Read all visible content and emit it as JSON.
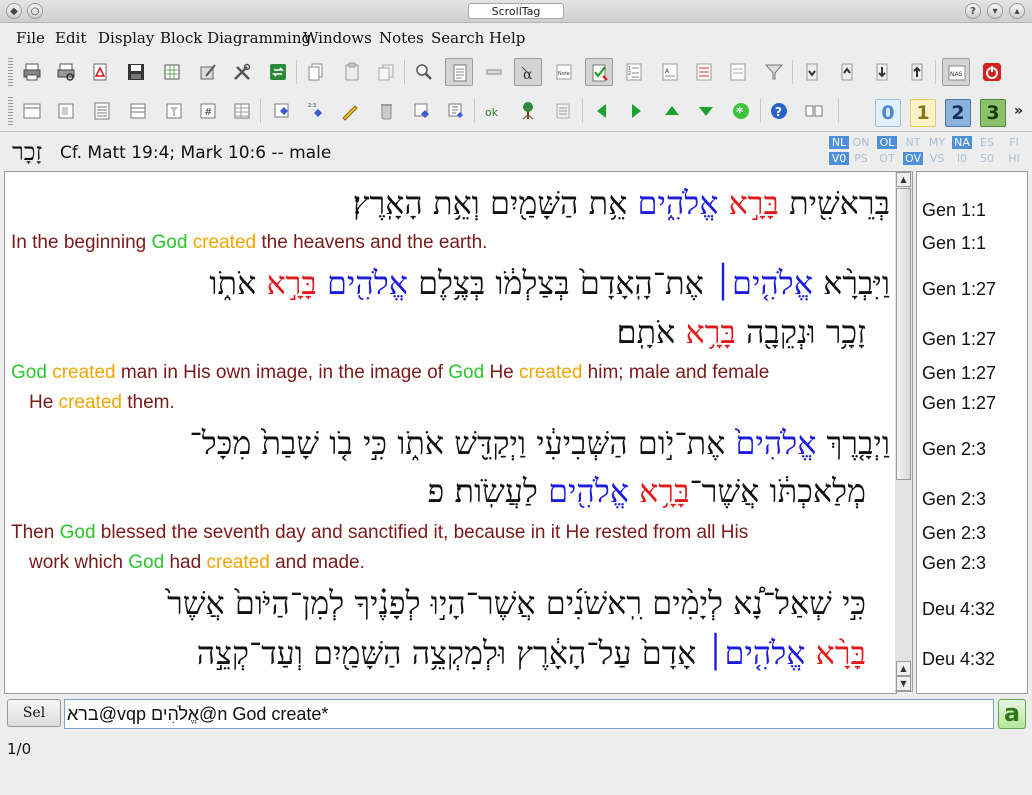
{
  "window": {
    "title": "ScrollTag"
  },
  "menu": [
    "File",
    "Edit",
    "Display",
    "Block Diagramming",
    "Windows",
    "Notes",
    "Search",
    "Help"
  ],
  "toolbar_numbers": [
    "0",
    "1",
    "2",
    "3"
  ],
  "toolbar_overflow": "»",
  "info": {
    "hebrew_word": "זָכָר",
    "definition": "Cf. Matt 19:4; Mark 10:6 -- male"
  },
  "flags_row1": [
    "NL",
    "ON",
    "OL",
    "NT",
    "MY",
    "NA",
    "ES",
    "FI"
  ],
  "flags_row2": [
    "V0",
    "PS",
    "OT",
    "OV",
    "VS",
    "I0",
    "S0",
    "HI"
  ],
  "text_lines": {
    "l1_heb_a": "בְּרֵאשִׁ֖ית ",
    "l1_heb_bara": "בָּרָ֣א",
    "l1_heb_elohim": "אֱלֹהִ֑ים",
    "l1_heb_b": " אֵ֥ת הַשָּׁמַ֖יִם וְאֵ֥ת הָאָֽרֶץ׃",
    "l2_a": "In the beginning ",
    "l2_god": "God",
    "l2_created": "created",
    "l2_b": " the heavens and the earth.",
    "l3_heb_a": "וַיִּבְרָ֨א ",
    "l3_heb_elohim": "אֱלֹהִ֤ים׀",
    "l3_heb_b": " אֶת־הָֽאָדָם֙ בְּצַלְמֹ֔ו בְּצֶ֥לֶם ",
    "l3_heb_elohim2": "אֱלֹהִ֖ים",
    "l3_heb_bara": "בָּרָ֣א",
    "l3_heb_c": " אֹתֹ֑ו",
    "l4_heb_a": "זָכָ֥ר וּנְקֵבָ֖ה ",
    "l4_heb_bara": "בָּרָ֥א",
    "l4_heb_b": " אֹתָֽם׃",
    "l5_god": "God",
    "l5_created": "created",
    "l5_a": " man in His own image, in the image of ",
    "l5_god2": "God",
    "l5_b": " He ",
    "l5_created2": "created",
    "l5_c": " him; male and female",
    "l6_a": "He ",
    "l6_created": "created",
    "l6_b": " them.",
    "l7_heb_a": "וַיְבָ֤רֶךְ ",
    "l7_heb_elohim": "אֱלֹהִים֙",
    "l7_heb_b": " אֶת־יֹ֣ום הַשְּׁבִיעִ֔י וַיְקַדֵּ֖שׁ אֹתֹ֑ו כִּ֣י בֹ֤ו שָׁבַת֙ מִכָּל־",
    "l8_heb_a": "מְלַאכְתֹּ֔ו אֲשֶׁר־",
    "l8_heb_bara": "בָּרָ֥א",
    "l8_heb_elohim": "אֱלֹהִ֖ים",
    "l8_heb_b": " לַעֲשֹֽׂות׃ פ",
    "l9_a": "Then ",
    "l9_god": "God",
    "l9_b": " blessed the seventh day and sanctified it, because in it He rested from all His",
    "l10_a": "work which ",
    "l10_god": "God",
    "l10_b": " had ",
    "l10_created": "created",
    "l10_c": " and made.",
    "l11_heb": "כִּ֣י שְׁאַל־נָ֠א לְיָמִ֨ים רִֽאשֹׁנִ֜ים אֲשֶׁר־הָי֣וּ לְפָנֶ֗יךָ לְמִן־הַיֹּום֙ אֲשֶׁר֙",
    "l12_heb_bara": "בָּרָ֨א",
    "l12_heb_elohim": "אֱלֹהִ֤ים׀",
    "l12_heb_b": " אָדָם֙ עַל־הָאָ֔רֶץ וּלְמִקְצֵ֥ה הַשָּׁמַ֖יִם וְעַד־קְצֵ֣ה"
  },
  "refs": [
    "Gen 1:1",
    "Gen 1:1",
    "Gen 1:27",
    "Gen 1:27",
    "Gen 1:27",
    "Gen 1:27",
    "Gen 2:3",
    "Gen 2:3",
    "Gen 2:3",
    "Gen 2:3",
    "Deu 4:32",
    "Deu 4:32"
  ],
  "bottom": {
    "sel_label": "Sel",
    "search_value": "ברא@vqp אֱלֹהִים@n God create*",
    "a_label": "a"
  },
  "status": "1/0",
  "colors": {
    "god": "#2cc52c",
    "created": "#f0a500",
    "bara": "#e41818",
    "elohim": "#1a1ae0",
    "english": "#7a1a1a"
  }
}
